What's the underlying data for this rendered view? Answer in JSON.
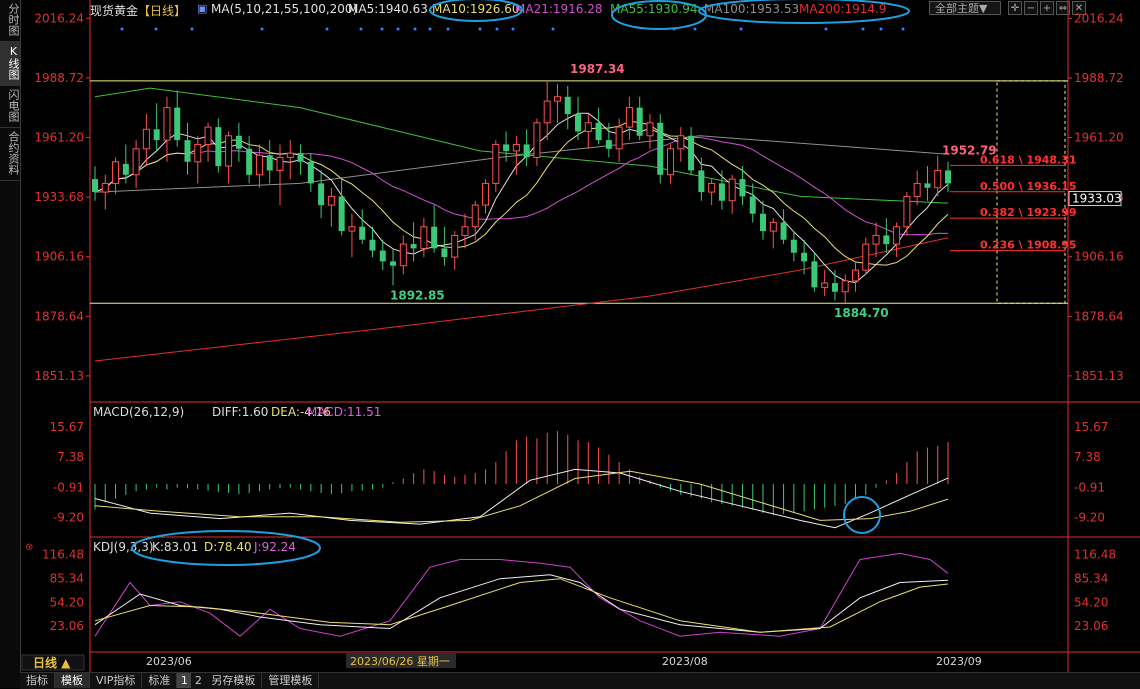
{
  "sidebar": {
    "tabs": [
      {
        "label": "分时图"
      },
      {
        "label": "K线图"
      },
      {
        "label": "闪电图"
      },
      {
        "label": "合约资料"
      }
    ],
    "active": 1
  },
  "header": {
    "instrument": "现货黄金",
    "period": "【日线】",
    "ma_label": "MA(5,10,21,55,100,200)",
    "ma_values": [
      {
        "text": "MA5:1940.63",
        "color": "#e0e0e0"
      },
      {
        "text": "MA10:1926.60",
        "color": "#e8e070"
      },
      {
        "text": "MA21:1916.28",
        "color": "#d050d0"
      },
      {
        "text": "MA55:1930.94",
        "color": "#40c040"
      },
      {
        "text": "MA100:1953.53",
        "color": "#909090"
      },
      {
        "text": "MA200:1914.9",
        "color": "#e03030"
      }
    ],
    "theme_button": "全部主题▼",
    "toolbar_icons": [
      "crosshair-icon",
      "minus-icon",
      "plus-icon",
      "move-icon",
      "close-icon"
    ]
  },
  "colors": {
    "up": "#ff5050",
    "down": "#3cc878",
    "axis": "#e03030",
    "fib": "#ff3030",
    "annot_circle": "#1ea0e0"
  },
  "main_axis": {
    "ticks": [
      "2016.24",
      "1988.72",
      "1961.20",
      "1933.68",
      "1906.16",
      "1878.64",
      "1851.13"
    ],
    "current_price": "1933.03",
    "ymin": 1840,
    "ymax": 2021
  },
  "price_labels": {
    "high1": "1987.34",
    "low1": "1892.85",
    "low2": "1884.70",
    "high2": "1952.79"
  },
  "fib_levels": [
    {
      "label": "0.618 \\ 1948.31",
      "value": 1948.31
    },
    {
      "label": "0.500 \\ 1936.15",
      "value": 1936.15
    },
    {
      "label": "0.382 \\ 1923.99",
      "value": 1923.99
    },
    {
      "label": "0.236 \\ 1908.95",
      "value": 1908.95
    }
  ],
  "macd": {
    "title": "MACD(26,12,9)",
    "diff": "DIFF:1.60",
    "dea": "DEA:-4.16",
    "macd": "MACD:11.51",
    "ticks": [
      "15.67",
      "7.38",
      "-0.91",
      "-9.20"
    ]
  },
  "kdj": {
    "title": "KDJ(9,3,3)",
    "k": "K:83.01",
    "d": "D:78.40",
    "j": "J:92.24",
    "ticks": [
      "116.48",
      "85.34",
      "54.20",
      "23.06"
    ]
  },
  "xaxis": {
    "labels": [
      "2023/06",
      "2023/06/26 星期一",
      "2023/08",
      "2023/09"
    ],
    "period_button": "日线 ▲"
  },
  "bottom_tabs": {
    "tabs": [
      "指标",
      "模板",
      "VIP指标",
      "标准"
    ],
    "nums": [
      "1",
      "2"
    ],
    "tabs2": [
      "另存模板",
      "管理模板"
    ],
    "active_tab": 1,
    "active_num": 0
  },
  "chart_data": {
    "type": "candlestick",
    "candles": [
      [
        1942,
        1948,
        1932,
        1936
      ],
      [
        1936,
        1944,
        1928,
        1940
      ],
      [
        1940,
        1952,
        1935,
        1950
      ],
      [
        1949,
        1958,
        1940,
        1944
      ],
      [
        1944,
        1960,
        1938,
        1956
      ],
      [
        1956,
        1972,
        1948,
        1965
      ],
      [
        1965,
        1977,
        1955,
        1960
      ],
      [
        1960,
        1980,
        1950,
        1975
      ],
      [
        1975,
        1983,
        1957,
        1960
      ],
      [
        1960,
        1968,
        1944,
        1950
      ],
      [
        1950,
        1962,
        1940,
        1958
      ],
      [
        1958,
        1968,
        1950,
        1966
      ],
      [
        1966,
        1970,
        1945,
        1948
      ],
      [
        1948,
        1964,
        1940,
        1962
      ],
      [
        1962,
        1968,
        1950,
        1956
      ],
      [
        1956,
        1962,
        1940,
        1944
      ],
      [
        1944,
        1958,
        1938,
        1953
      ],
      [
        1953,
        1960,
        1940,
        1946
      ],
      [
        1946,
        1958,
        1930,
        1952
      ],
      [
        1952,
        1960,
        1942,
        1954
      ],
      [
        1954,
        1958,
        1944,
        1950
      ],
      [
        1950,
        1954,
        1936,
        1940
      ],
      [
        1940,
        1946,
        1924,
        1930
      ],
      [
        1930,
        1938,
        1920,
        1934
      ],
      [
        1934,
        1942,
        1916,
        1918
      ],
      [
        1918,
        1926,
        1906,
        1920
      ],
      [
        1920,
        1928,
        1912,
        1914
      ],
      [
        1914,
        1920,
        1906,
        1909
      ],
      [
        1909,
        1914,
        1900,
        1904
      ],
      [
        1904,
        1910,
        1892.85,
        1902
      ],
      [
        1902,
        1916,
        1898,
        1912
      ],
      [
        1912,
        1922,
        1904,
        1910
      ],
      [
        1910,
        1924,
        1906,
        1920
      ],
      [
        1920,
        1930,
        1908,
        1910
      ],
      [
        1910,
        1920,
        1902,
        1906
      ],
      [
        1906,
        1918,
        1900,
        1916
      ],
      [
        1916,
        1926,
        1910,
        1920
      ],
      [
        1920,
        1932,
        1914,
        1930
      ],
      [
        1930,
        1942,
        1926,
        1940
      ],
      [
        1940,
        1960,
        1936,
        1958
      ],
      [
        1958,
        1964,
        1950,
        1955
      ],
      [
        1955,
        1962,
        1944,
        1958
      ],
      [
        1958,
        1965,
        1948,
        1952
      ],
      [
        1952,
        1970,
        1948,
        1968
      ],
      [
        1968,
        1987.34,
        1960,
        1978
      ],
      [
        1978,
        1986,
        1968,
        1980
      ],
      [
        1980,
        1985,
        1965,
        1972
      ],
      [
        1972,
        1980,
        1960,
        1964
      ],
      [
        1964,
        1972,
        1956,
        1968
      ],
      [
        1968,
        1975,
        1958,
        1960
      ],
      [
        1960,
        1968,
        1952,
        1956
      ],
      [
        1956,
        1970,
        1950,
        1966
      ],
      [
        1966,
        1980,
        1960,
        1975
      ],
      [
        1975,
        1980,
        1960,
        1962
      ],
      [
        1962,
        1972,
        1956,
        1968
      ],
      [
        1968,
        1972,
        1940,
        1944
      ],
      [
        1944,
        1958,
        1940,
        1956
      ],
      [
        1956,
        1966,
        1950,
        1962
      ],
      [
        1962,
        1966,
        1944,
        1946
      ],
      [
        1946,
        1952,
        1932,
        1936
      ],
      [
        1936,
        1942,
        1930,
        1940
      ],
      [
        1940,
        1946,
        1928,
        1932
      ],
      [
        1932,
        1944,
        1926,
        1942
      ],
      [
        1942,
        1948,
        1930,
        1934
      ],
      [
        1934,
        1940,
        1922,
        1926
      ],
      [
        1926,
        1932,
        1914,
        1918
      ],
      [
        1918,
        1924,
        1910,
        1922
      ],
      [
        1922,
        1928,
        1912,
        1914
      ],
      [
        1914,
        1918,
        1904,
        1908
      ],
      [
        1908,
        1914,
        1898,
        1904
      ],
      [
        1904,
        1908,
        1890,
        1892
      ],
      [
        1892,
        1900,
        1888,
        1894
      ],
      [
        1894,
        1900,
        1886,
        1890
      ],
      [
        1890,
        1898,
        1884.7,
        1895
      ],
      [
        1895,
        1904,
        1890,
        1900
      ],
      [
        1900,
        1915,
        1898,
        1912
      ],
      [
        1912,
        1922,
        1906,
        1916
      ],
      [
        1916,
        1924,
        1908,
        1912
      ],
      [
        1912,
        1922,
        1906,
        1920
      ],
      [
        1920,
        1936,
        1916,
        1934
      ],
      [
        1934,
        1946,
        1930,
        1940
      ],
      [
        1940,
        1948,
        1932,
        1938
      ],
      [
        1938,
        1952.79,
        1934,
        1946
      ],
      [
        1946,
        1950,
        1936,
        1940
      ]
    ],
    "ma200": {
      "start": 1858,
      "end": 1914.9
    }
  }
}
